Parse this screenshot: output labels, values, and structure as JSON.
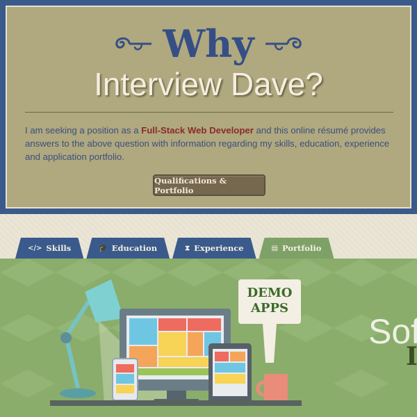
{
  "header": {
    "why": "Why",
    "subtitle": "Interview Dave?",
    "intro_before": "I am seeking a position as a ",
    "intro_highlight": "Full-Stack Web Developer",
    "intro_after": " and this online résumé provides answers to the above question with information regarding my skills, education, experience and application portfolio.",
    "cta_label": "Qualifications & Portfolio"
  },
  "tabs": [
    {
      "label": "Skills",
      "icon": "code-icon",
      "active": false
    },
    {
      "label": "Education",
      "icon": "graduation-cap-icon",
      "active": false
    },
    {
      "label": "Experience",
      "icon": "hourglass-icon",
      "active": false
    },
    {
      "label": "Portfolio",
      "icon": "book-icon",
      "active": true
    }
  ],
  "hero": {
    "demo_line1": "DEMO",
    "demo_line2": "APPS",
    "big_word": "Sof",
    "big_word2": "I"
  },
  "colors": {
    "header_frame": "#3a5a8c",
    "header_panel": "#b0a87e",
    "accent_red": "#8a2b2b",
    "hero_green": "#8aad6c",
    "tab_active": "#7ea167"
  }
}
